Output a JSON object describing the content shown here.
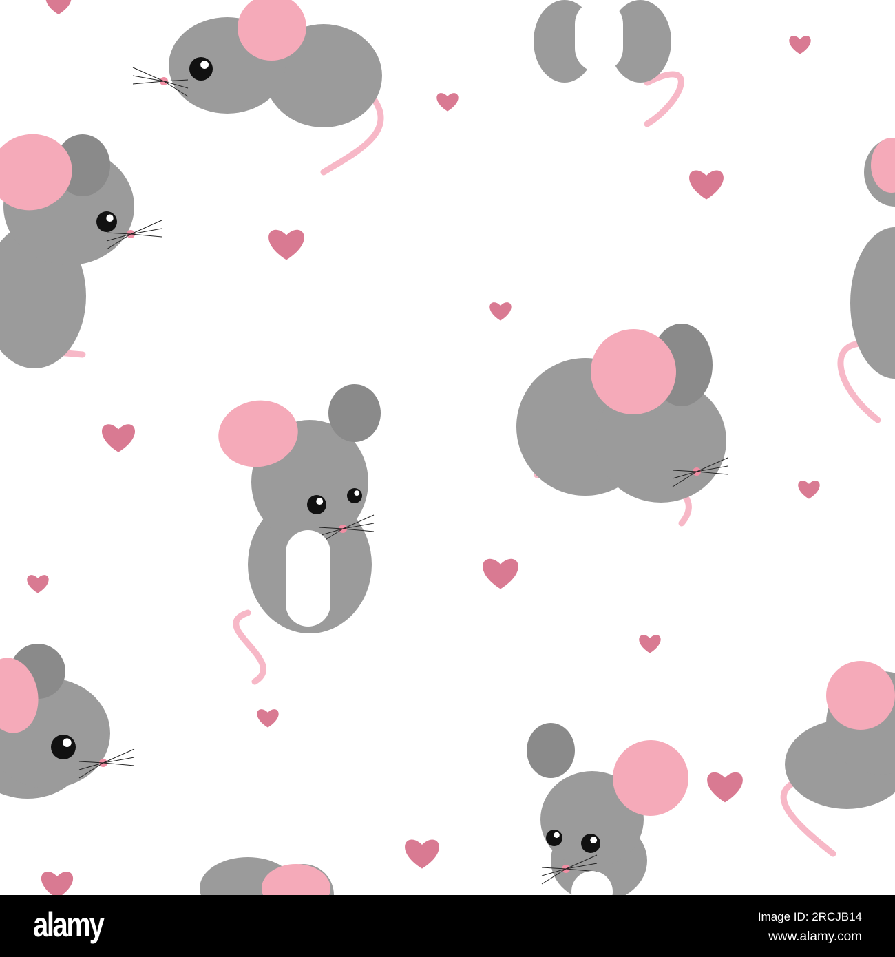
{
  "colors": {
    "body": "#9b9b9b",
    "body_dark": "#8a8a8a",
    "ear": "#f5aab9",
    "tail": "#f7b8c7",
    "heart": "#d97a92",
    "footer": "#000000"
  },
  "footer": {
    "logo": "alamy",
    "image_id": "Image ID: 2RCJB14",
    "url": "www.alamy.com"
  }
}
